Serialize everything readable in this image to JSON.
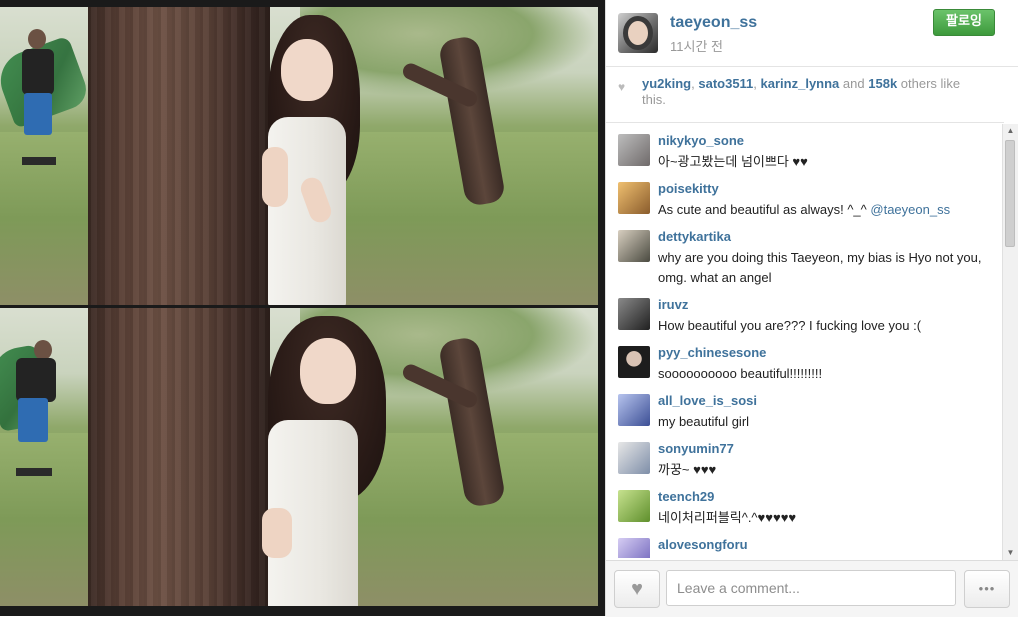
{
  "post": {
    "username": "taeyeon_ss",
    "time": "11시간 전",
    "follow_label": "팔로잉"
  },
  "likes": {
    "users": [
      "yu2king",
      "sato3511",
      "karinz_lynna"
    ],
    "count": "158k",
    "suffix_and": "and",
    "suffix_tail": "others like this."
  },
  "comments": [
    {
      "user": "nikykyo_sone",
      "text": "아~광고봤는데 넘이쁘다 ♥♥",
      "avatar_color": "#6f6a6a"
    },
    {
      "user": "poisekitty",
      "text": "As cute and beautiful as always! ^_^",
      "mention": "@taeyeon_ss",
      "avatar_color": "#c58f45"
    },
    {
      "user": "dettykartika",
      "text": "why are you doing this Taeyeon, my bias is Hyo not you, omg. what an angel",
      "avatar_color": "#5a5a4e"
    },
    {
      "user": "iruvz",
      "text": "How beautiful you are??? I fucking love you :(",
      "avatar_color": "#3d3d3d"
    },
    {
      "user": "pyy_chinesesone",
      "text": "soooooooooo beautiful!!!!!!!!!",
      "avatar_color": "#2a2a2a"
    },
    {
      "user": "all_love_is_sosi",
      "text": "my beautiful girl",
      "avatar_color": "#4c63a8"
    },
    {
      "user": "sonyumin77",
      "text": "까꿍~ ♥♥♥",
      "avatar_color": "#8a9ab0"
    },
    {
      "user": "teench29",
      "text": "네이처리퍼블릭^.^♥♥♥♥♥",
      "avatar_color": "#86b04a"
    },
    {
      "user": "alovesongforu",
      "text": "",
      "avatar_color": "#7c73c4"
    }
  ],
  "comment_box": {
    "placeholder": "Leave a comment...",
    "more_label": "•••"
  },
  "icons": {
    "like_small": "heart-icon",
    "like_button": "heart-icon",
    "scroll_up": "arrow-up-icon",
    "scroll_down": "arrow-down-icon"
  },
  "colors": {
    "link": "#3f729b",
    "follow_green": "#4aa84a",
    "muted": "#999999"
  }
}
